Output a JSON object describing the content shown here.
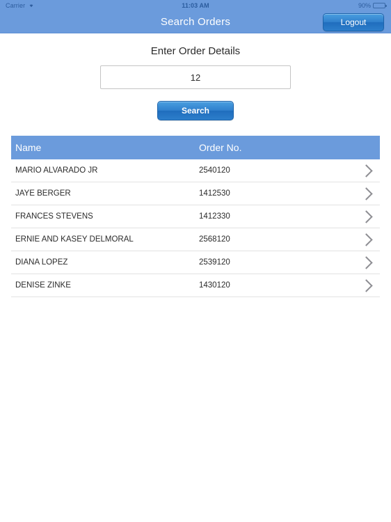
{
  "status_bar": {
    "carrier": "Carrier",
    "wifi_icon": "wifi-icon",
    "time": "11:03 AM",
    "battery_percent": "90%",
    "battery_icon": "battery-icon",
    "battery_level": 90,
    "background_color": "#6b9bdc"
  },
  "nav_bar": {
    "title": "Search Orders",
    "logout_label": "Logout",
    "background_color": "#6b9bdc",
    "button_accent": "#2f7fcc"
  },
  "form": {
    "heading": "Enter Order Details",
    "input_value": "12",
    "input_placeholder": "",
    "search_label": "Search"
  },
  "table": {
    "header_background": "#6b9bdc",
    "columns": [
      "Name",
      "Order No."
    ],
    "chevron_icon": "chevron-right-icon",
    "rows": [
      {
        "name": "MARIO ALVARADO JR",
        "order_no": "2540120"
      },
      {
        "name": "JAYE BERGER",
        "order_no": "1412530"
      },
      {
        "name": "FRANCES STEVENS",
        "order_no": "1412330"
      },
      {
        "name": "ERNIE AND KASEY DELMORAL",
        "order_no": "2568120"
      },
      {
        "name": "DIANA LOPEZ",
        "order_no": "2539120"
      },
      {
        "name": "DENISE ZINKE",
        "order_no": "1430120"
      }
    ]
  }
}
